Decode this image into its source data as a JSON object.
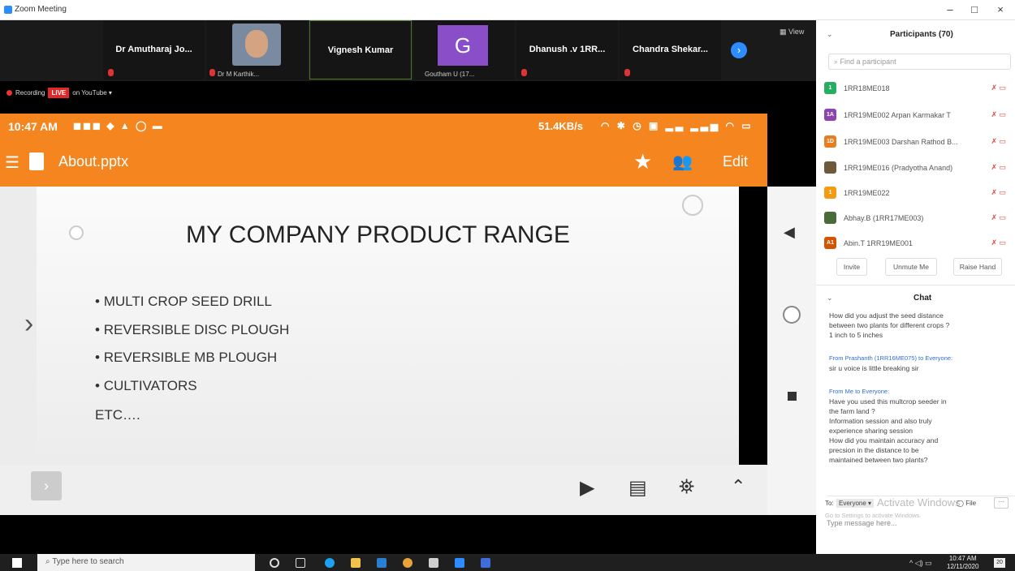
{
  "window": {
    "title": "Zoom Meeting",
    "minimize": "–",
    "maximize": "□",
    "close": "×"
  },
  "participants_strip": [
    {
      "name": "Dr Amutharaj Jo...",
      "type": "name"
    },
    {
      "name": "Dr M Karthik...",
      "type": "video"
    },
    {
      "name": "Vignesh Kumar",
      "type": "name"
    },
    {
      "name": "Goutham U (17...",
      "initial": "G",
      "type": "avatar"
    },
    {
      "name": "Dhanush .v 1RR...",
      "type": "name"
    },
    {
      "name": "Chandra Shekar...",
      "type": "name"
    }
  ],
  "view_label": "View",
  "recording": {
    "label": "Recording",
    "live": "LIVE",
    "platform": "on YouTube ▾"
  },
  "phone_status": {
    "time": "10:47 AM",
    "speed": "51.4KB/s"
  },
  "app": {
    "file": "About.pptx",
    "edit": "Edit"
  },
  "slide": {
    "title": "MY COMPANY PRODUCT RANGE",
    "bullets": [
      "MULTI CROP SEED DRILL",
      "REVERSIBLE DISC PLOUGH",
      "REVERSIBLE MB PLOUGH",
      "CULTIVATORS"
    ],
    "footer": "ETC…."
  },
  "participants_panel": {
    "title": "Participants (70)",
    "search_placeholder": "Find a participant",
    "list": [
      {
        "initials": "1",
        "color": "#27ae60",
        "name": "1RR18ME018"
      },
      {
        "initials": "1A",
        "color": "#8e44ad",
        "name": "1RR19ME002 Arpan Karmakar T"
      },
      {
        "initials": "1D",
        "color": "#e67e22",
        "name": "1RR19ME003 Darshan Rathod B..."
      },
      {
        "initials": "",
        "color": "#6b5b3a",
        "name": "1RR19ME016 (Pradyotha Anand)"
      },
      {
        "initials": "1",
        "color": "#f39c12",
        "name": "1RR19ME022"
      },
      {
        "initials": "",
        "color": "#4a6a3a",
        "name": "Abhay.B (1RR17ME003)"
      },
      {
        "initials": "A1",
        "color": "#d35400",
        "name": "Abin.T 1RR19ME001"
      }
    ],
    "buttons": [
      "Invite",
      "Unmute Me",
      "Raise Hand"
    ]
  },
  "chat": {
    "title": "Chat",
    "lines": [
      "How did you adjust the seed distance",
      "between two plants for different crops ?",
      "1 inch to 5 inches"
    ],
    "msg2_from": "From Prashanth (1RR16ME075) to Everyone:",
    "msg2_text": "sir u voice is little breaking sir",
    "msg3_from": "From Me to Everyone:",
    "msg3_lines": [
      "Have you used this multcrop seeder in",
      "the farm land ?",
      "Information session and also truly",
      "experience sharing session",
      "How did you maintain accuracy and",
      "precsion in the distance to be",
      "maintained between two plants?"
    ],
    "to_label": "To:",
    "to_value": "Everyone ▾",
    "file_label": "File",
    "more_label": "···",
    "input_placeholder": "Type message here...",
    "watermark1": "Activate Windows",
    "watermark2": "Go to Settings to activate Windows."
  },
  "taskbar": {
    "search_placeholder": "Type here to search",
    "time": "10:47 AM",
    "date": "12/11/2020",
    "notif": "20"
  }
}
